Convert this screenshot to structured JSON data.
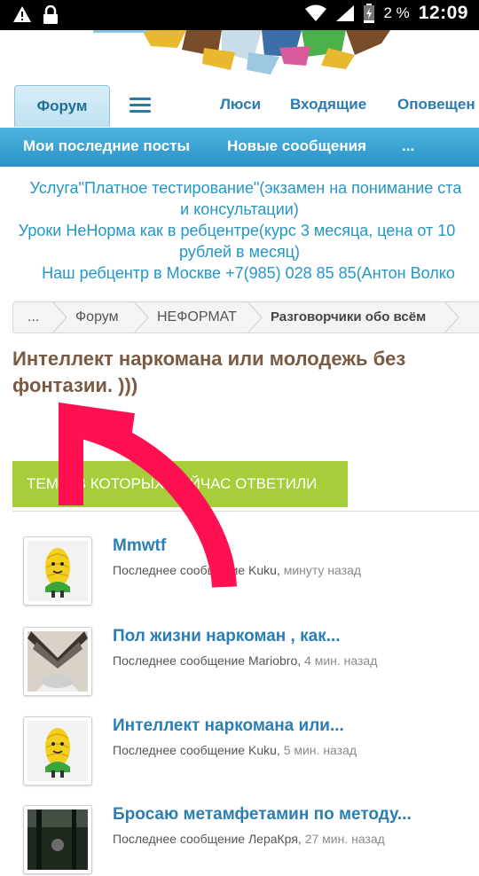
{
  "status_bar": {
    "battery": "2 %",
    "time": "12:09"
  },
  "nav": {
    "forum_tab": "Форум",
    "links": [
      "Люси",
      "Входящие",
      "Оповещен"
    ]
  },
  "subnav": {
    "links": [
      "Мои последние посты",
      "Новые сообщения",
      "..."
    ]
  },
  "notice": {
    "lines": [
      "Услуга\"Платное тестирование\"(экзамен на понимание ста",
      "и консультации)",
      "Уроки НеНорма как в ребцентре(курс 3 месяца, цена от 10",
      "рублей в месяц)",
      "Наш ребцентр в Москве +7(985) 028 85 85(Антон Волко"
    ]
  },
  "breadcrumb": [
    "...",
    "Форум",
    "НЕФОРМАТ",
    "Разговорчики обо всём"
  ],
  "page_title": "Интеллект наркомана или молодежь без фонтазии. )))",
  "recent_button": "ТЕМЫ В КОТОРЫХ СЕЙЧАС ОТВЕТИЛИ",
  "threads": [
    {
      "title": "Mmwtf",
      "prefix": "Последнее сообщение",
      "user": "Kuku",
      "time": "минуту назад",
      "avatar": "corn-avatar"
    },
    {
      "title": "Пол жизни наркоман , как...",
      "prefix": "Последнее сообщение",
      "user": "Mariobro",
      "time": "4 мин. назад",
      "avatar": "wings-avatar"
    },
    {
      "title": "Интеллект наркомана или...",
      "prefix": "Последнее сообщение",
      "user": "Kuku",
      "time": "5 мин. назад",
      "avatar": "corn-avatar"
    },
    {
      "title": "Бросаю метамфетамин по методу...",
      "prefix": "Последнее сообщение",
      "user": "ЛераКря",
      "time": "27 мин. назад",
      "avatar": "forest-avatar"
    }
  ],
  "colors": {
    "accent": "#2a93c6",
    "title_brown": "#7a5a43",
    "button_green": "#a6cd3a",
    "arrow_red": "#ff1050"
  }
}
